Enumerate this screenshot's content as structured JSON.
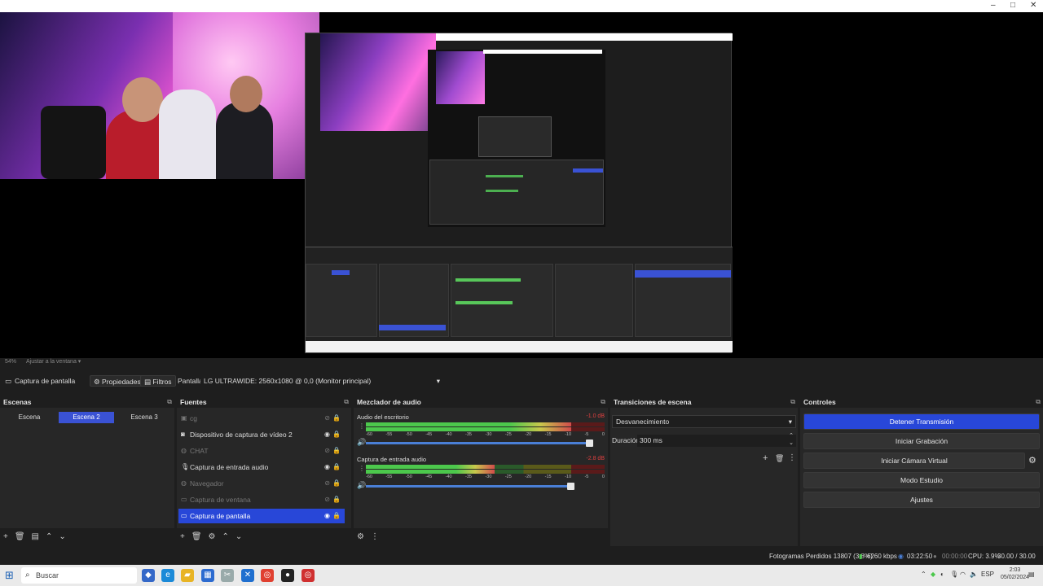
{
  "window": {
    "minimize": "–",
    "maximize": "□",
    "close": "✕"
  },
  "preview": {
    "scale_label": "54%",
    "fit_label": "Ajustar a la ventana"
  },
  "context": {
    "source_name": "Captura de pantalla",
    "properties": "Propiedades",
    "filters": "Filtros",
    "display_label": "Pantalla",
    "display_value": "LG ULTRAWIDE: 2560x1080 @ 0,0 (Monitor principal)"
  },
  "scenes": {
    "title": "Escenas",
    "items": [
      {
        "label": "Escena"
      },
      {
        "label": "Escena 2"
      },
      {
        "label": "Escena 3"
      }
    ]
  },
  "sources": {
    "title": "Fuentes",
    "items": [
      {
        "label": "cg"
      },
      {
        "label": "Dispositivo de captura de vídeo 2"
      },
      {
        "label": "CHAT"
      },
      {
        "label": "Captura de entrada audio"
      },
      {
        "label": "Navegador"
      },
      {
        "label": "Captura de ventana"
      },
      {
        "label": "Captura de pantalla"
      }
    ]
  },
  "mixer": {
    "title": "Mezclador de audio",
    "channels": [
      {
        "name": "Audio del escritorio",
        "db": "-1.0 dB",
        "level": 0.86,
        "volume": 0.94
      },
      {
        "name": "Captura de entrada audio",
        "db": "-2.8 dB",
        "level": 0.54,
        "volume": 0.86
      }
    ],
    "scale": [
      "-60",
      "-55",
      "-50",
      "-45",
      "-40",
      "-35",
      "-30",
      "-25",
      "-20",
      "-15",
      "-10",
      "-5",
      "0"
    ]
  },
  "transitions": {
    "title": "Transiciones de escena",
    "selected": "Desvanecimiento",
    "duration_label": "Duración",
    "duration_value": "300 ms"
  },
  "controls": {
    "title": "Controles",
    "stop_stream": "Detener Transmisión",
    "start_recording": "Iniciar Grabación",
    "start_virtual_cam": "Iniciar Cámara Virtual",
    "studio_mode": "Modo Estudio",
    "settings": "Ajustes"
  },
  "status": {
    "dropped_frames": "Fotogramas Perdidos 13807 (3.8%)",
    "bitrate": "6260 kbps",
    "stream_time": "03:22:50",
    "rec_time": "00:00:00",
    "cpu": "CPU: 3.9%",
    "fps": "30.00 / 30.00 FPS"
  },
  "taskbar": {
    "search": "Buscar",
    "lang": "ESP",
    "time": "2:03",
    "date": "05/02/2024"
  },
  "colors": {
    "accent": "#2847d8",
    "meter_green": "#4cc84c",
    "meter_red": "#d24b4b"
  }
}
